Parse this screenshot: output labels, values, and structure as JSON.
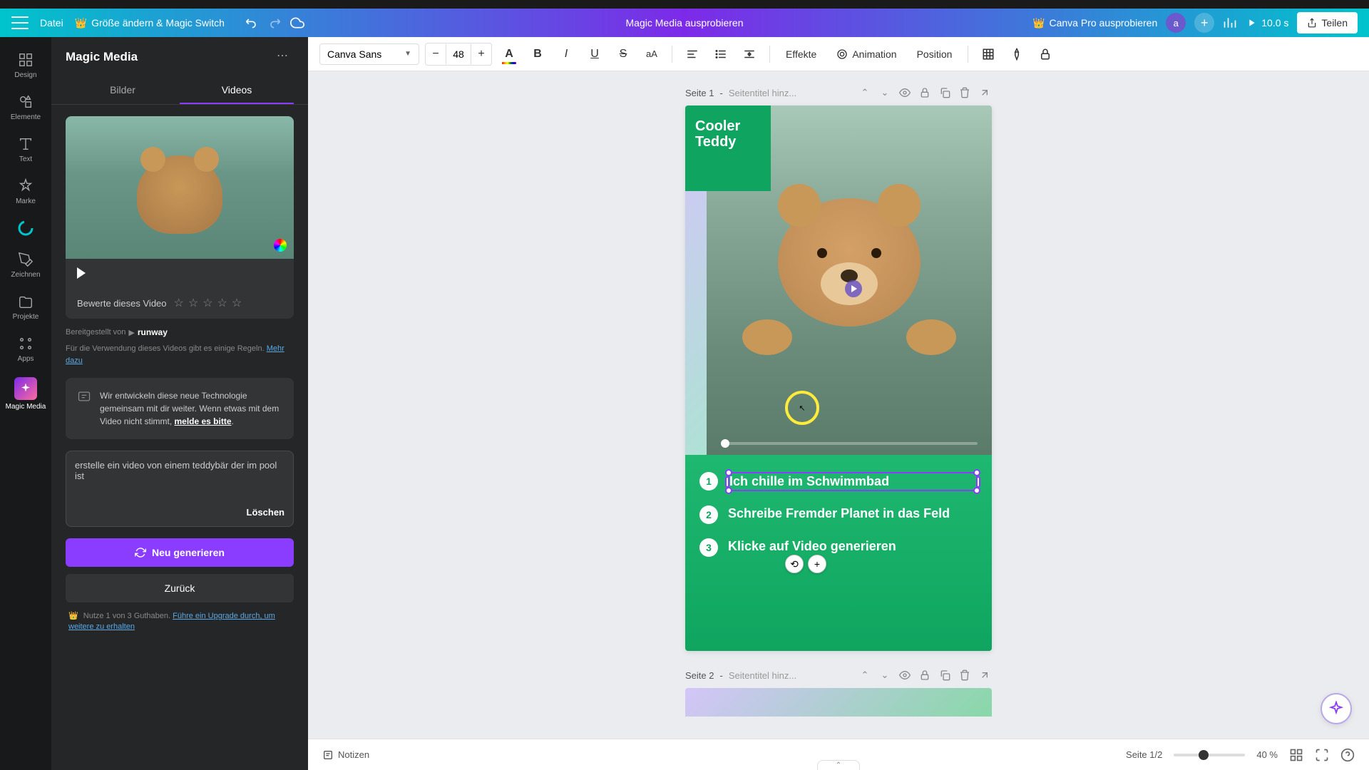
{
  "header": {
    "file": "Datei",
    "resize": "Größe ändern & Magic Switch",
    "doc_title": "Magic Media ausprobieren",
    "pro_cta": "Canva Pro ausprobieren",
    "avatar_letter": "a",
    "duration": "10.0 s",
    "share": "Teilen"
  },
  "rail": {
    "design": "Design",
    "elements": "Elemente",
    "text": "Text",
    "brand": "Marke",
    "draw": "Zeichnen",
    "projects": "Projekte",
    "apps": "Apps",
    "magic_media": "Magic Media"
  },
  "panel": {
    "title": "Magic Media",
    "tab_images": "Bilder",
    "tab_videos": "Videos",
    "rating_label": "Bewerte dieses Video",
    "provider_prefix": "Bereitgestellt von",
    "provider_name": "runway",
    "rules_text": "Für die Verwendung dieses Videos gibt es einige Regeln.",
    "rules_link": "Mehr dazu",
    "info_text": "Wir entwickeln diese neue Technologie gemeinsam mit dir weiter. Wenn etwas mit dem Video nicht stimmt, ",
    "info_link": "melde es bitte",
    "prompt_text": "erstelle ein video von einem teddybär der im pool ist",
    "clear": "Löschen",
    "generate": "Neu generieren",
    "back": "Zurück",
    "credits_text": "Nutze 1 von 3 Guthaben.",
    "credits_link": "Führe ein Upgrade durch, um weitere zu erhalten"
  },
  "toolbar": {
    "font": "Canva Sans",
    "size": "48",
    "effects": "Effekte",
    "animation": "Animation",
    "position": "Position"
  },
  "page1": {
    "label": "Seite 1",
    "title_placeholder": "Seitentitel hinz...",
    "cooler_teddy": "Cooler Teddy",
    "step1": "Ich chille im Schwimmbad",
    "step2_a": "Schreibe ",
    "step2_b": "Fremder Planet",
    "step2_c": " in das Feld",
    "step3_a": "Klicke auf ",
    "step3_b": "Video generieren"
  },
  "page2": {
    "label": "Seite 2",
    "title_placeholder": "Seitentitel hinz..."
  },
  "footer": {
    "notes": "Notizen",
    "page_indicator": "Seite 1/2",
    "zoom": "40 %"
  }
}
